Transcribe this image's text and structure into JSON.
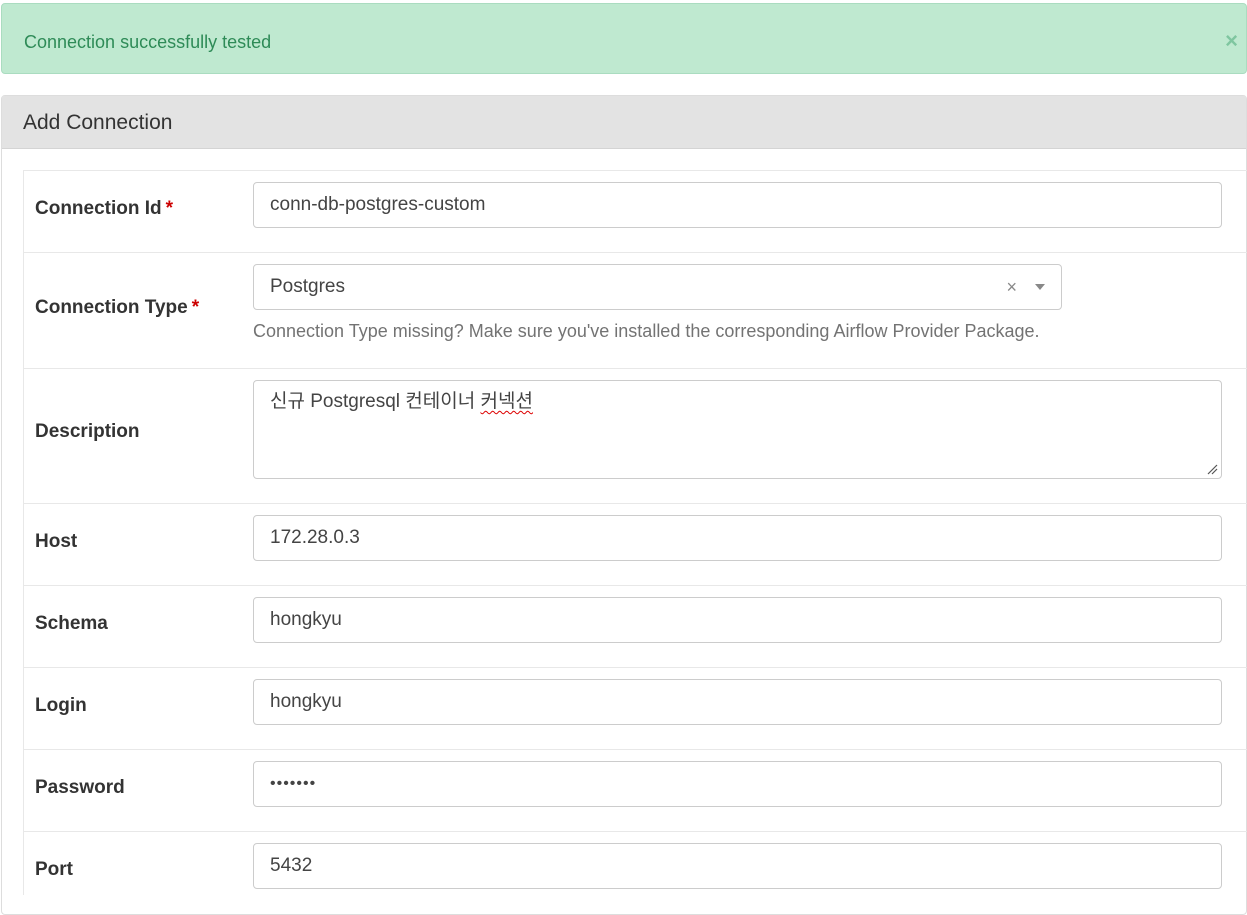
{
  "alert": {
    "message": "Connection successfully tested",
    "close_label": "×"
  },
  "panel": {
    "title": "Add Connection"
  },
  "form": {
    "connection_id": {
      "label": "Connection Id",
      "required_mark": "*",
      "value": "conn-db-postgres-custom"
    },
    "connection_type": {
      "label": "Connection Type",
      "required_mark": "*",
      "value": "Postgres",
      "clear_label": "×",
      "help": "Connection Type missing? Make sure you've installed the corresponding Airflow Provider Package."
    },
    "description": {
      "label": "Description",
      "value_prefix": "신규 Postgresql 컨테이너 ",
      "value_misspelled": "커넥션"
    },
    "host": {
      "label": "Host",
      "value": "172.28.0.3"
    },
    "schema": {
      "label": "Schema",
      "value": "hongkyu"
    },
    "login": {
      "label": "Login",
      "value": "hongkyu"
    },
    "password": {
      "label": "Password",
      "value": "•••••••"
    },
    "port": {
      "label": "Port",
      "value": "5432"
    }
  },
  "colors": {
    "alert_bg": "#bfe9d0",
    "alert_text": "#2e8b57",
    "required": "#cc0000",
    "panel_heading_bg": "#e3e3e3"
  }
}
